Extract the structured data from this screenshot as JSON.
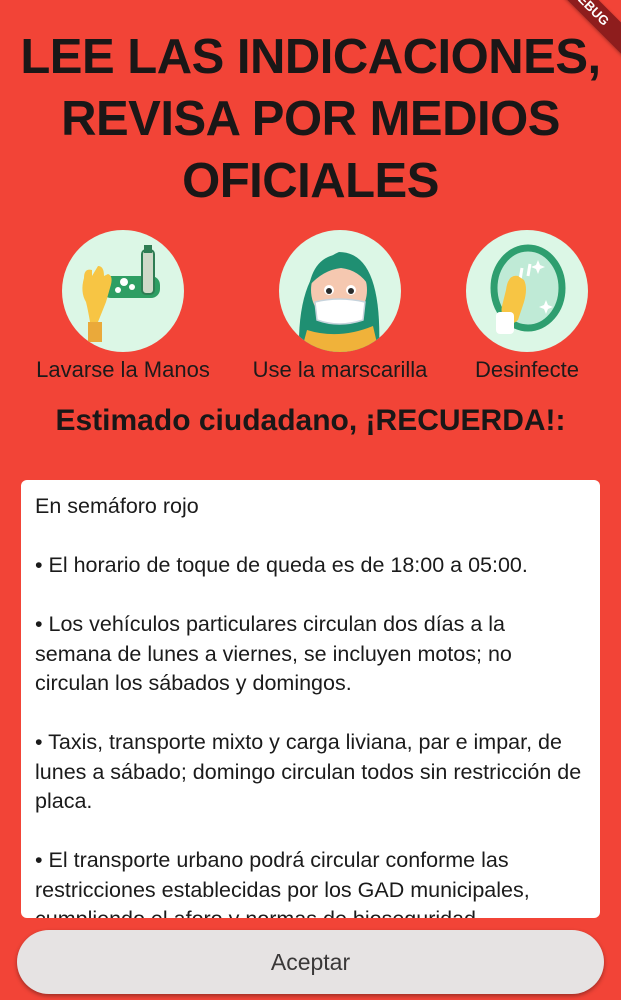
{
  "header": {
    "title_lines": [
      "LEE LAS INDICACIONES,",
      "REVISA POR MEDIOS",
      "OFICIALES"
    ],
    "debug_banner": "DEBUG"
  },
  "icons": [
    {
      "icon": "hand-washing-icon",
      "label": "Lavarse la Manos"
    },
    {
      "icon": "face-mask-icon",
      "label": "Use la marscarilla"
    },
    {
      "icon": "disinfect-icon",
      "label": "Desinfecte"
    }
  ],
  "subtitle": "Estimado ciudadano, ¡RECUERDA!:",
  "message": {
    "paragraphs": [
      "En semáforo rojo",
      "• El horario de toque de queda es de 18:00 a 05:00.",
      " • Los vehículos particulares circulan dos días a la semana de lunes a viernes, se incluyen motos; no circulan los sábados y domingos.",
      "• Taxis, transporte mixto y carga liviana, par e impar, de lunes a sábado; domingo circulan todos sin restricción de placa.",
      "• El transporte urbano podrá circular conforme las restricciones establecidas por los GAD municipales, cumpliendo el aforo y normas de bioseguridad."
    ]
  },
  "actions": {
    "accept_label": "Aceptar"
  },
  "colors": {
    "background": "#f24437",
    "card": "#ffffff",
    "icon_circle": "#dcf7e6",
    "button": "#e6e3e3"
  }
}
